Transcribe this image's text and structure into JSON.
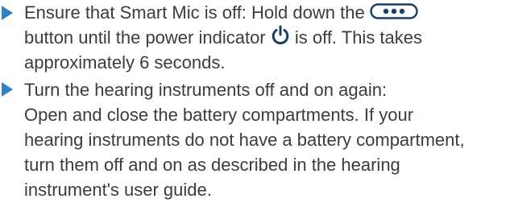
{
  "colors": {
    "text": "#3c3c3c",
    "bullet": "#2f83c5",
    "icon": "#1a3d63"
  },
  "icons": {
    "button_icon": "three-dot-button-icon",
    "power_icon": "power-icon"
  },
  "item1": {
    "line1_before": "Ensure that Smart Mic is off: Hold down the ",
    "line2_before": "button until the power indicator ",
    "line2_after": " is off. This takes",
    "line3": "approximately 6 seconds."
  },
  "item2": {
    "line1": "Turn the hearing instruments off and on again:",
    "line2": "Open and close the battery compartments. If your",
    "line3": "hearing instruments do not have a battery compartment,",
    "line4": "turn them off and on as described in the hearing",
    "line5": "instrument's user guide."
  }
}
